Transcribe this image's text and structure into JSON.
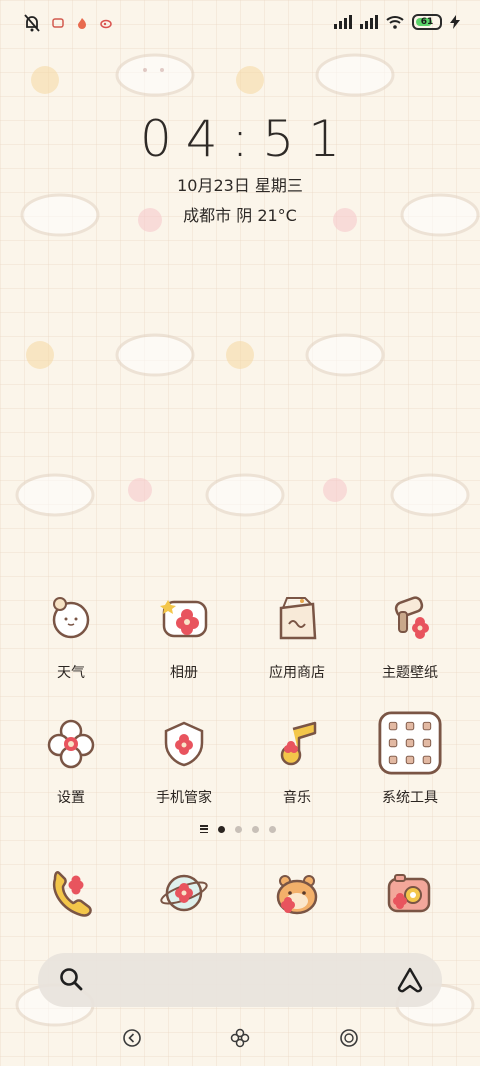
{
  "status_bar": {
    "left_icons": [
      "bell-off-icon",
      "app-notification-icon",
      "flame-notification-icon",
      "weibo-notification-icon"
    ],
    "right_icons": [
      "signal-icon",
      "signal-icon",
      "wifi-icon",
      "battery-icon",
      "charging-icon"
    ],
    "battery_level": "61"
  },
  "clock": {
    "time": "04:51",
    "date": "10月23日 星期三",
    "weather": "成都市 阴 21°C"
  },
  "apps": [
    {
      "label": "天气",
      "icon": "weather-icon"
    },
    {
      "label": "相册",
      "icon": "gallery-icon"
    },
    {
      "label": "应用商店",
      "icon": "app-store-icon"
    },
    {
      "label": "主题壁纸",
      "icon": "theme-wallpaper-icon"
    },
    {
      "label": "设置",
      "icon": "settings-icon"
    },
    {
      "label": "手机管家",
      "icon": "security-icon"
    },
    {
      "label": "音乐",
      "icon": "music-icon"
    },
    {
      "label": "系统工具",
      "icon": "system-tools-folder-icon"
    }
  ],
  "page_indicator": {
    "pages": 4,
    "current": 1
  },
  "dock": [
    "phone-icon",
    "browser-icon",
    "messages-icon",
    "camera-icon"
  ],
  "search_bar": {
    "left_icon": "search-icon",
    "right_icon": "assistant-icon"
  },
  "nav": [
    "back-icon",
    "home-icon",
    "recents-icon"
  ],
  "colors": {
    "background": "#fbf5ea",
    "flower_red": "#e8545e",
    "icon_outline": "#7a5545",
    "accent_yellow": "#f3c64a"
  }
}
